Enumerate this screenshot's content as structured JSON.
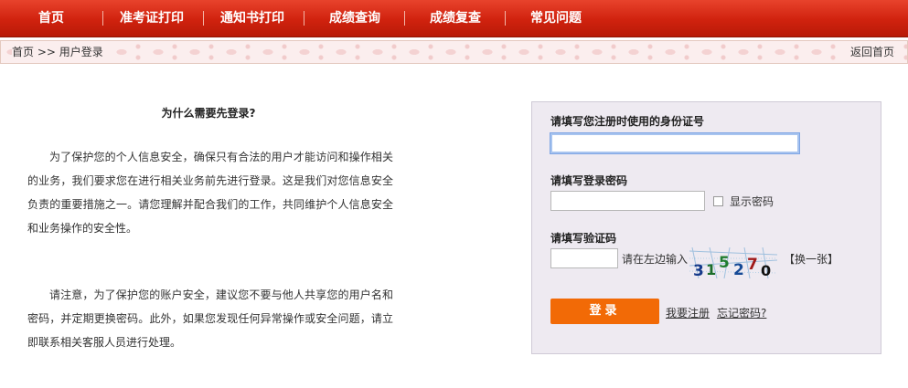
{
  "nav": {
    "items": [
      {
        "label": "首页"
      },
      {
        "label": "准考证打印"
      },
      {
        "label": "通知书打印"
      },
      {
        "label": "成绩查询"
      },
      {
        "label": "成绩复查"
      },
      {
        "label": "常见问题"
      }
    ]
  },
  "breadcrumb": {
    "path": "首页 >> 用户登录",
    "home_link": "返回首页"
  },
  "info": {
    "title": "为什么需要先登录?",
    "para1": "为了保护您的个人信息安全，确保只有合法的用户才能访问和操作相关的业务，我们要求您在进行相关业务前先进行登录。这是我们对您信息安全负责的重要措施之一。请您理解并配合我们的工作，共同维护个人信息安全和业务操作的安全性。",
    "para2": "请注意，为了保护您的账户安全，建议您不要与他人共享您的用户名和密码，并定期更换密码。此外，如果您发现任何异常操作或安全问题，请立即联系相关客服人员进行处理。"
  },
  "login": {
    "id_label": "请填写您注册时使用的身份证号",
    "id_value": "",
    "password_label": "请填写登录密码",
    "password_value": "",
    "show_password_label": "显示密码",
    "captcha_label": "请填写验证码",
    "captcha_value": "",
    "captcha_hint": "请在左边输入",
    "captcha_text": "315270",
    "refresh_captcha": "【换一张】",
    "submit_label": "登录",
    "register_link": "我要注册",
    "forgot_link": "忘记密码?"
  },
  "colors": {
    "nav_red": "#d0220e",
    "button_orange": "#f26a06",
    "panel_bg": "#eeeaf1"
  }
}
